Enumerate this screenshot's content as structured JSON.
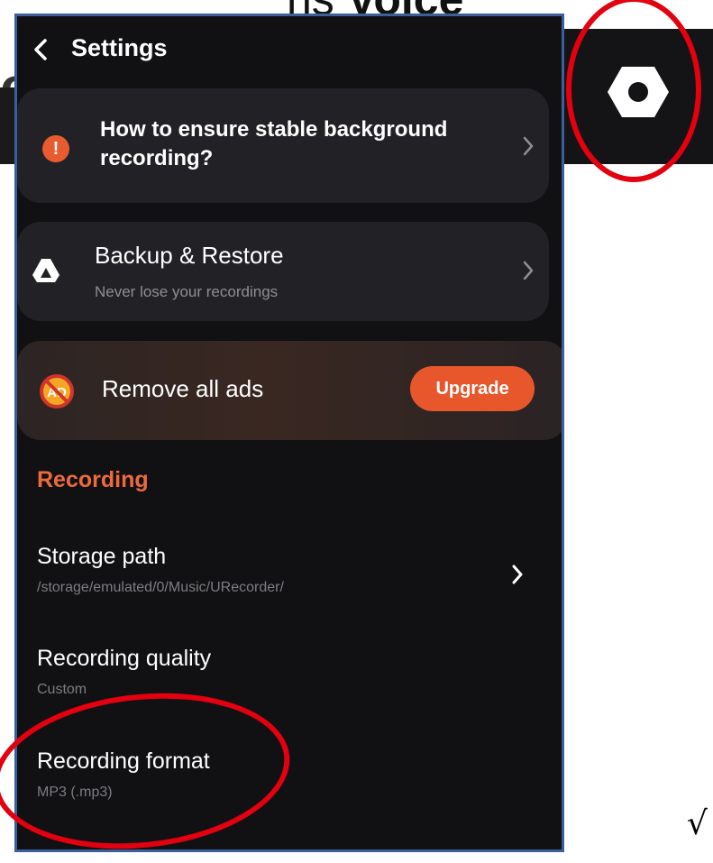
{
  "background": {
    "title_prefix": "ns ",
    "title_bold": "Voice",
    "left_fragment": "e"
  },
  "header": {
    "title": "Settings",
    "back_icon": "chevron-left-icon"
  },
  "cards": {
    "stability": {
      "text": "How to ensure stable background recording?",
      "icon": "warning-icon",
      "icon_glyph": "!"
    },
    "backup": {
      "title": "Backup & Restore",
      "subtitle": "Never lose your recordings",
      "icon": "drive-icon"
    },
    "ads": {
      "text": "Remove all ads",
      "button_label": "Upgrade",
      "icon": "no-ads-icon"
    }
  },
  "section": {
    "label": "Recording"
  },
  "settings": [
    {
      "title": "Storage path",
      "value": "/storage/emulated/0/Music/URecorder/"
    },
    {
      "title": "Recording quality",
      "value": "Custom"
    },
    {
      "title": "Recording format",
      "value": "MP3 (.mp3)"
    }
  ],
  "annotations": {
    "checkmark": "√"
  },
  "colors": {
    "accent": "#e8572c",
    "section": "#ee6a3c",
    "background": "#111113",
    "card": "#222226",
    "highlight_ring": "#e3000f"
  }
}
